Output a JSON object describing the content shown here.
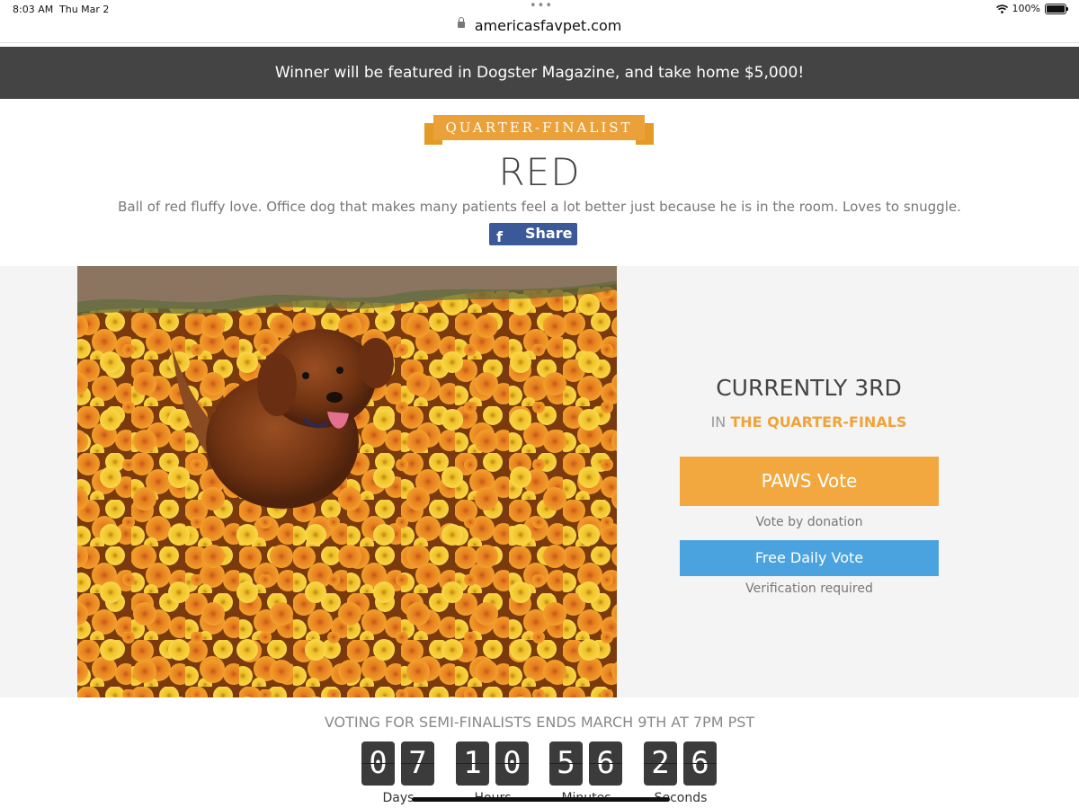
{
  "status_bar": {
    "time": "8:03 AM",
    "date": "Thu Mar 2",
    "battery": "100%"
  },
  "browser": {
    "url": "americasfavpet.com"
  },
  "banner": {
    "text": "Winner will be featured in Dogster Magazine, and take home $5,000!"
  },
  "pet": {
    "badge": "QUARTER-FINALIST",
    "name": "RED",
    "description": "Ball of red fluffy love. Office dog that makes many patients feel a lot better just because he is in the room. Loves to snuggle.",
    "share_label": "Share",
    "share_icon": "f"
  },
  "ranking": {
    "title": "CURRENTLY 3RD",
    "prefix": "IN",
    "stage": "THE QUARTER-FINALS"
  },
  "vote": {
    "paws_label": "PAWS Vote",
    "paws_note": "Vote by donation",
    "free_label": "Free Daily Vote",
    "free_note": "Verification required"
  },
  "countdown": {
    "message": "VOTING FOR SEMI-FINALISTS ENDS MARCH 9TH AT 7PM PST",
    "days": [
      "0",
      "7"
    ],
    "hours": [
      "1",
      "0"
    ],
    "minutes": [
      "5",
      "6"
    ],
    "seconds": [
      "2",
      "6"
    ],
    "labels": {
      "days": "Days",
      "hours": "Hours",
      "minutes": "Minutes",
      "seconds": "Seconds"
    }
  },
  "colors": {
    "banner_bg": "#444444",
    "accent_orange": "#f2a83e",
    "accent_blue": "#4aa3df",
    "facebook_blue": "#3b5998"
  }
}
